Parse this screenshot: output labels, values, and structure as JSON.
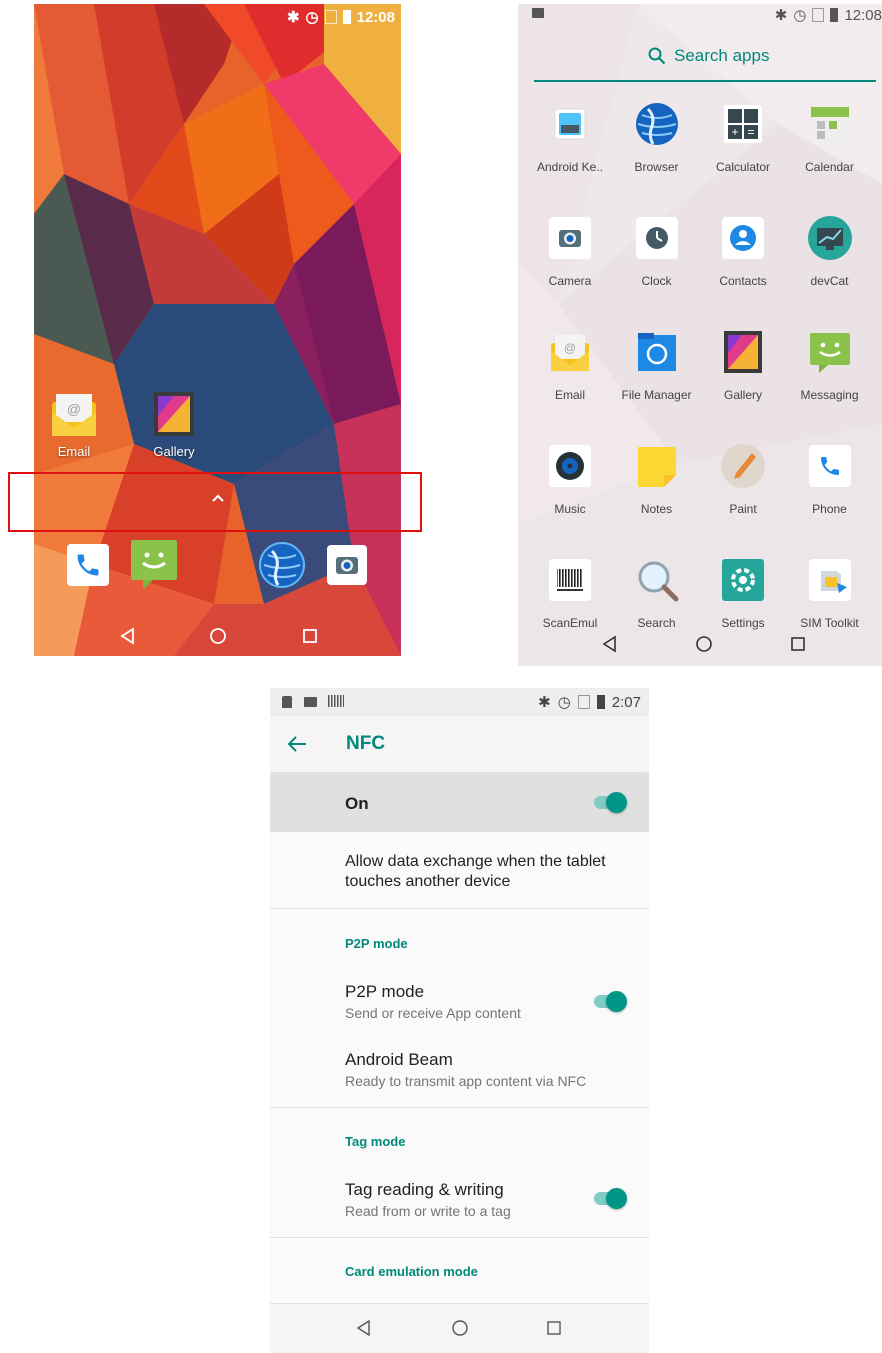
{
  "home": {
    "status_time": "12:08",
    "desktop_apps": [
      {
        "label": "Email",
        "icon": "email-icon"
      },
      {
        "label": "Gallery",
        "icon": "gallery-icon"
      }
    ],
    "app_drawer_handle_icon": "chevron-up-icon",
    "dock_icons": [
      "phone-icon",
      "messaging-icon",
      "browser-icon",
      "camera-icon"
    ],
    "highlight_color": "#e01010"
  },
  "drawer": {
    "status_time": "12:08",
    "search_label": "Search apps",
    "accent": "#00897b",
    "apps": [
      {
        "label": "Android Ke..",
        "icon": "keyboard-icon"
      },
      {
        "label": "Browser",
        "icon": "browser-icon"
      },
      {
        "label": "Calculator",
        "icon": "calculator-icon"
      },
      {
        "label": "Calendar",
        "icon": "calendar-icon"
      },
      {
        "label": "Camera",
        "icon": "camera-icon"
      },
      {
        "label": "Clock",
        "icon": "clock-icon"
      },
      {
        "label": "Contacts",
        "icon": "contacts-icon"
      },
      {
        "label": "devCat",
        "icon": "devcat-icon"
      },
      {
        "label": "Email",
        "icon": "email-icon"
      },
      {
        "label": "File Manager",
        "icon": "file-manager-icon"
      },
      {
        "label": "Gallery",
        "icon": "gallery-icon"
      },
      {
        "label": "Messaging",
        "icon": "messaging-icon"
      },
      {
        "label": "Music",
        "icon": "music-icon"
      },
      {
        "label": "Notes",
        "icon": "notes-icon"
      },
      {
        "label": "Paint",
        "icon": "paint-icon"
      },
      {
        "label": "Phone",
        "icon": "phone-icon"
      },
      {
        "label": "ScanEmul",
        "icon": "barcode-icon"
      },
      {
        "label": "Search",
        "icon": "search-icon"
      },
      {
        "label": "Settings",
        "icon": "settings-icon"
      },
      {
        "label": "SIM Toolkit",
        "icon": "sim-toolkit-icon"
      }
    ]
  },
  "nfc": {
    "status_time": "2:07",
    "title": "NFC",
    "accent": "#009688",
    "master_switch": {
      "label": "On",
      "checked": true
    },
    "description": "Allow data exchange when the tablet touches another device",
    "sections": [
      {
        "header": "P2P mode",
        "items": [
          {
            "title": "P2P mode",
            "summary": "Send or receive App content",
            "switch": true
          },
          {
            "title": "Android Beam",
            "summary": "Ready to transmit app content via NFC",
            "switch": null
          }
        ]
      },
      {
        "header": "Tag mode",
        "items": [
          {
            "title": "Tag reading & writing",
            "summary": "Read from or write to a tag",
            "switch": true
          }
        ]
      },
      {
        "header": "Card emulation mode",
        "items": []
      }
    ]
  }
}
